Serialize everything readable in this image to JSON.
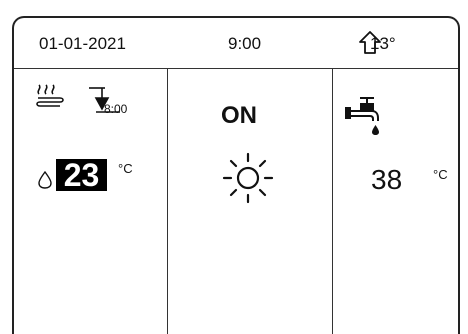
{
  "header": {
    "date": "01-01-2021",
    "time": "9:00",
    "outdoor_temp": "13°",
    "outdoor_icon": "house-icon"
  },
  "zone1": {
    "icons": [
      "floor-heating-icon",
      "schedule-down-icon"
    ],
    "schedule_time": "8:00",
    "drop_icon": "droplet-icon",
    "setpoint": "23",
    "unit": "°C"
  },
  "mode": {
    "status": "ON",
    "icon": "sun-icon"
  },
  "dhw": {
    "icon": "water-tap-icon",
    "temperature": "38",
    "unit": "°C"
  }
}
